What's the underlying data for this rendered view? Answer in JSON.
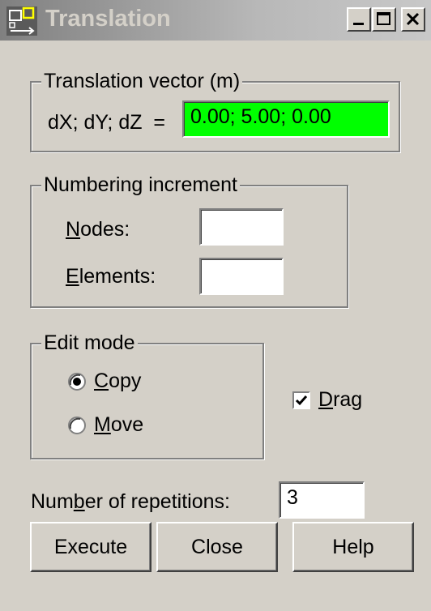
{
  "window": {
    "title": "Translation"
  },
  "translation_vector": {
    "legend": "Translation vector (m)",
    "label": "dX; dY; dZ  =",
    "value": "0.00; 5.00; 0.00",
    "value_bg_color": "#00ff00"
  },
  "numbering_increment": {
    "legend": "Numbering increment",
    "nodes_label_mnemonic": "N",
    "nodes_label_rest": "odes:",
    "nodes_value": "",
    "elements_label_mnemonic": "E",
    "elements_label_rest": "lements:",
    "elements_value": ""
  },
  "edit_mode": {
    "legend": "Edit mode",
    "options": [
      {
        "mnemonic": "C",
        "rest": "opy",
        "selected": true
      },
      {
        "mnemonic": "M",
        "rest": "ove",
        "selected": false
      }
    ]
  },
  "drag": {
    "mnemonic": "D",
    "rest": "rag",
    "checked": true
  },
  "repetitions": {
    "label_before": "Num",
    "label_mnemonic": "b",
    "label_after": "er of repetitions:",
    "value": "3"
  },
  "buttons": {
    "execute": "Execute",
    "close": "Close",
    "help": "Help"
  },
  "icons": {
    "app": "translation-app-icon",
    "minimize": "minimize-icon",
    "maximize": "maximize-icon",
    "close": "close-icon",
    "radio_selected": "radio-selected-icon",
    "radio_unselected": "radio-unselected-icon",
    "checkmark": "checkmark-icon"
  }
}
